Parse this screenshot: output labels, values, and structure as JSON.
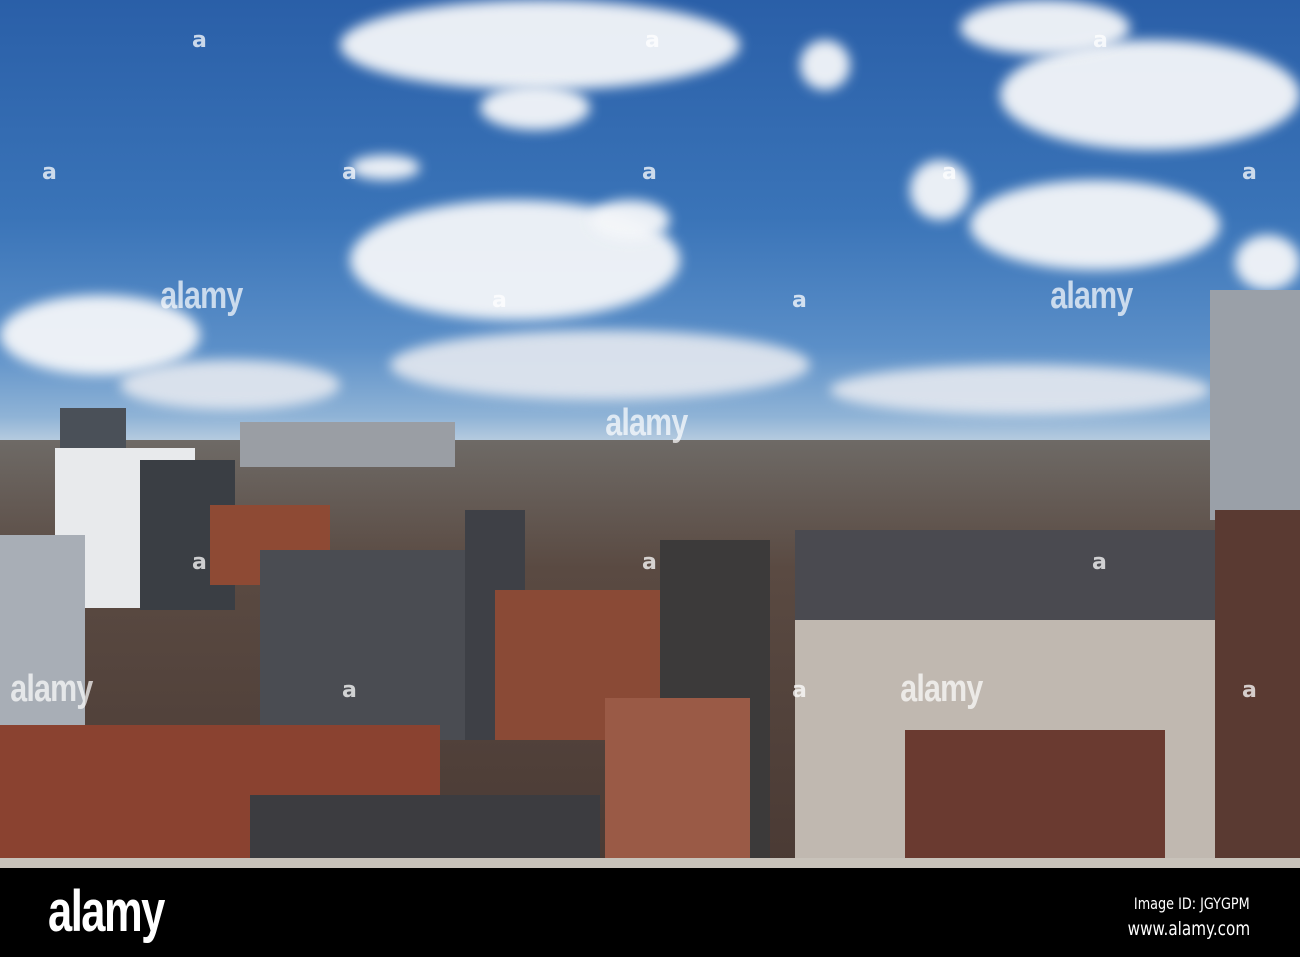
{
  "watermark": {
    "text": "alamy",
    "mark": "a"
  },
  "footer": {
    "logo": "alamy",
    "image_id": "Image ID: JGYGPM",
    "url": "www.alamy.com"
  }
}
